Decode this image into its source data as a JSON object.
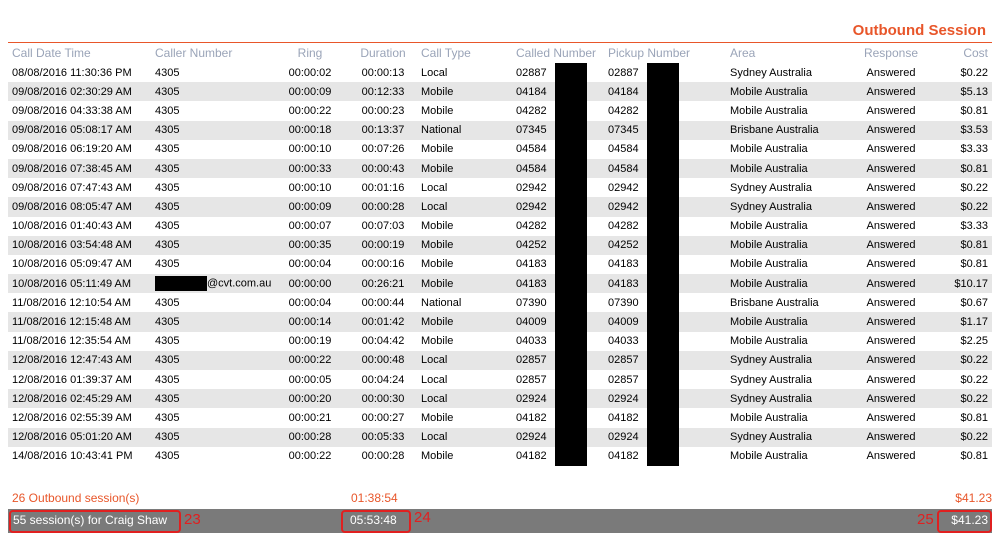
{
  "page": {
    "title": "Outbound Session"
  },
  "table": {
    "headers": [
      "Call Date Time",
      "Caller Number",
      "Ring",
      "Duration",
      "Call Type",
      "Called Number",
      "Pickup Number",
      "Area",
      "Response",
      "Cost"
    ],
    "rows": [
      [
        "08/08/2016 11:30:36 PM",
        "4305",
        "00:00:02",
        "00:00:13",
        "Local",
        "02887",
        "02887",
        "Sydney Australia",
        "Answered",
        "$0.22"
      ],
      [
        "09/08/2016 02:30:29 AM",
        "4305",
        "00:00:09",
        "00:12:33",
        "Mobile",
        "04184",
        "04184",
        "Mobile Australia",
        "Answered",
        "$5.13"
      ],
      [
        "09/08/2016 04:33:38 AM",
        "4305",
        "00:00:22",
        "00:00:23",
        "Mobile",
        "04282",
        "04282",
        "Mobile Australia",
        "Answered",
        "$0.81"
      ],
      [
        "09/08/2016 05:08:17 AM",
        "4305",
        "00:00:18",
        "00:13:37",
        "National",
        "07345",
        "07345",
        "Brisbane Australia",
        "Answered",
        "$3.53"
      ],
      [
        "09/08/2016 06:19:20 AM",
        "4305",
        "00:00:10",
        "00:07:26",
        "Mobile",
        "04584",
        "04584",
        "Mobile Australia",
        "Answered",
        "$3.33"
      ],
      [
        "09/08/2016 07:38:45 AM",
        "4305",
        "00:00:33",
        "00:00:43",
        "Mobile",
        "04584",
        "04584",
        "Mobile Australia",
        "Answered",
        "$0.81"
      ],
      [
        "09/08/2016 07:47:43 AM",
        "4305",
        "00:00:10",
        "00:01:16",
        "Local",
        "02942",
        "02942",
        "Sydney Australia",
        "Answered",
        "$0.22"
      ],
      [
        "09/08/2016 08:05:47 AM",
        "4305",
        "00:00:09",
        "00:00:28",
        "Local",
        "02942",
        "02942",
        "Sydney Australia",
        "Answered",
        "$0.22"
      ],
      [
        "10/08/2016 01:40:43 AM",
        "4305",
        "00:00:07",
        "00:07:03",
        "Mobile",
        "04282",
        "04282",
        "Mobile Australia",
        "Answered",
        "$3.33"
      ],
      [
        "10/08/2016 03:54:48 AM",
        "4305",
        "00:00:35",
        "00:00:19",
        "Mobile",
        "04252",
        "04252",
        "Mobile Australia",
        "Answered",
        "$0.81"
      ],
      [
        "10/08/2016 05:09:47 AM",
        "4305",
        "00:00:04",
        "00:00:16",
        "Mobile",
        "04183",
        "04183",
        "Mobile Australia",
        "Answered",
        "$0.81"
      ],
      [
        "10/08/2016 05:11:49 AM",
        "@cvt.com.au",
        "00:00:00",
        "00:26:21",
        "Mobile",
        "04183",
        "04183",
        "Mobile Australia",
        "Answered",
        "$10.17"
      ],
      [
        "11/08/2016 12:10:54 AM",
        "4305",
        "00:00:04",
        "00:00:44",
        "National",
        "07390",
        "07390",
        "Brisbane Australia",
        "Answered",
        "$0.67"
      ],
      [
        "11/08/2016 12:15:48 AM",
        "4305",
        "00:00:14",
        "00:01:42",
        "Mobile",
        "04009",
        "04009",
        "Mobile Australia",
        "Answered",
        "$1.17"
      ],
      [
        "11/08/2016 12:35:54 AM",
        "4305",
        "00:00:19",
        "00:04:42",
        "Mobile",
        "04033",
        "04033",
        "Mobile Australia",
        "Answered",
        "$2.25"
      ],
      [
        "12/08/2016 12:47:43 AM",
        "4305",
        "00:00:22",
        "00:00:48",
        "Local",
        "02857",
        "02857",
        "Sydney Australia",
        "Answered",
        "$0.22"
      ],
      [
        "12/08/2016 01:39:37 AM",
        "4305",
        "00:00:05",
        "00:04:24",
        "Local",
        "02857",
        "02857",
        "Sydney Australia",
        "Answered",
        "$0.22"
      ],
      [
        "12/08/2016 02:45:29 AM",
        "4305",
        "00:00:20",
        "00:00:30",
        "Local",
        "02924",
        "02924",
        "Sydney Australia",
        "Answered",
        "$0.22"
      ],
      [
        "12/08/2016 02:55:39 AM",
        "4305",
        "00:00:21",
        "00:00:27",
        "Mobile",
        "04182",
        "04182",
        "Mobile Australia",
        "Answered",
        "$0.81"
      ],
      [
        "12/08/2016 05:01:20 AM",
        "4305",
        "00:00:28",
        "00:05:33",
        "Local",
        "02924",
        "02924",
        "Sydney Australia",
        "Answered",
        "$0.22"
      ],
      [
        "14/08/2016 10:43:41 PM",
        "4305",
        "00:00:22",
        "00:00:28",
        "Mobile",
        "04182",
        "04182",
        "Mobile Australia",
        "Answered",
        "$0.81"
      ]
    ]
  },
  "summary": {
    "sessions": "26 Outbound session(s)",
    "duration": "01:38:54",
    "cost": "$41.23"
  },
  "footer": {
    "sessions": "55 session(s) for Craig Shaw",
    "duration": "05:53:48",
    "cost": "$41.23"
  },
  "annotations": {
    "a23": "23",
    "a24": "24",
    "a25": "25"
  },
  "colors": {
    "accent": "#e8562a",
    "annotation": "#e02020",
    "footer_bg": "#7a7a7a"
  }
}
